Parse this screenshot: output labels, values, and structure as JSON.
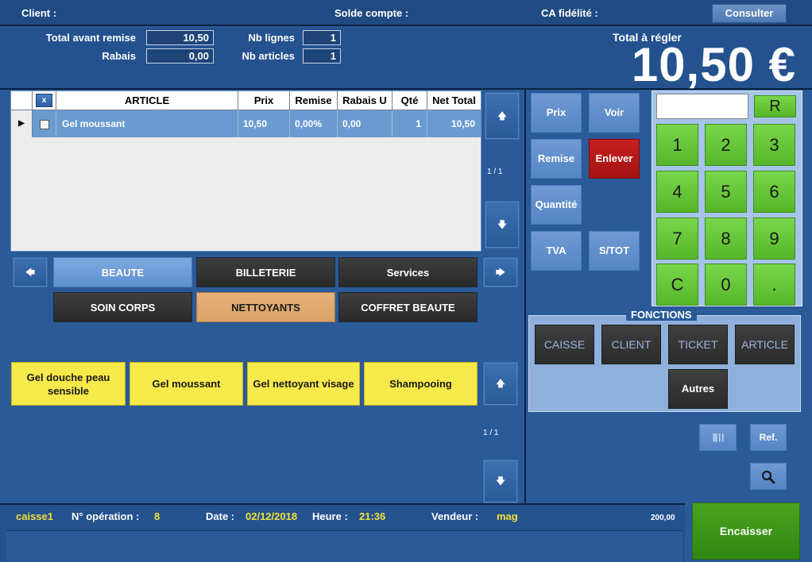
{
  "header": {
    "client_label": "Client :",
    "solde_label": "Solde compte :",
    "ca_label": "CA fidélité :",
    "consulter_label": "Consulter"
  },
  "totals": {
    "total_avant_remise_label": "Total avant remise",
    "total_avant_remise_value": "10,50",
    "rabais_label": "Rabais",
    "rabais_value": "0,00",
    "nb_lignes_label": "Nb lignes",
    "nb_lignes_value": "1",
    "nb_articles_label": "Nb articles",
    "nb_articles_value": "1",
    "total_a_regler_label": "Total à régler",
    "total_a_regler_value": "10,50 €"
  },
  "table": {
    "delete_header": "x",
    "columns": [
      "ARTICLE",
      "Prix",
      "Remise",
      "Rabais U",
      "Qté",
      "Net Total"
    ],
    "rows": [
      {
        "article": "Gel moussant",
        "prix": "10,50",
        "remise": "0,00%",
        "rabais_u": "0,00",
        "qte": "1",
        "net_total": "10,50"
      }
    ],
    "page_indicator": "1 / 1"
  },
  "categories": {
    "row1": [
      "BEAUTE",
      "BILLETERIE",
      "Services"
    ],
    "row2": [
      "SOIN CORPS",
      "NETTOYANTS",
      "COFFRET BEAUTE"
    ]
  },
  "products": {
    "items": [
      "Gel douche peau sensible",
      "Gel moussant",
      "Gel nettoyant visage",
      "Shampooing"
    ],
    "page_indicator": "1 / 1"
  },
  "actions": {
    "prix": "Prix",
    "voir": "Voir",
    "remise": "Remise",
    "enlever": "Enlever",
    "quantite": "Quantité",
    "tva": "TVA",
    "stot": "S/TOT"
  },
  "keypad": {
    "input_value": "",
    "reset": "R",
    "keys": [
      "1",
      "2",
      "3",
      "4",
      "5",
      "6",
      "7",
      "8",
      "9",
      "C",
      "0",
      "."
    ]
  },
  "fonctions": {
    "title": "FONCTIONS",
    "caisse": "CAISSE",
    "client": "CLIENT",
    "ticket": "TICKET",
    "article": "ARTICLE",
    "autres": "Autres"
  },
  "tools": {
    "barcode": "||| | |",
    "ref": "Ref."
  },
  "status": {
    "caisse": "caisse1",
    "operation_label": "N° opération :",
    "operation_value": "8",
    "date_label": "Date :",
    "date_value": "02/12/2018",
    "heure_label": "Heure :",
    "heure_value": "21:36",
    "vendeur_label": "Vendeur :",
    "vendeur_value": "mag",
    "amount": "200,00"
  },
  "encaisser_label": "Encaisser",
  "colors": {
    "background": "#2a5a98",
    "keypad_green": "#56b62a",
    "product_yellow": "#f6e94a",
    "enlever_red": "#a51212",
    "encaisser_green": "#2f8712",
    "status_yellow": "#f2e13a"
  }
}
